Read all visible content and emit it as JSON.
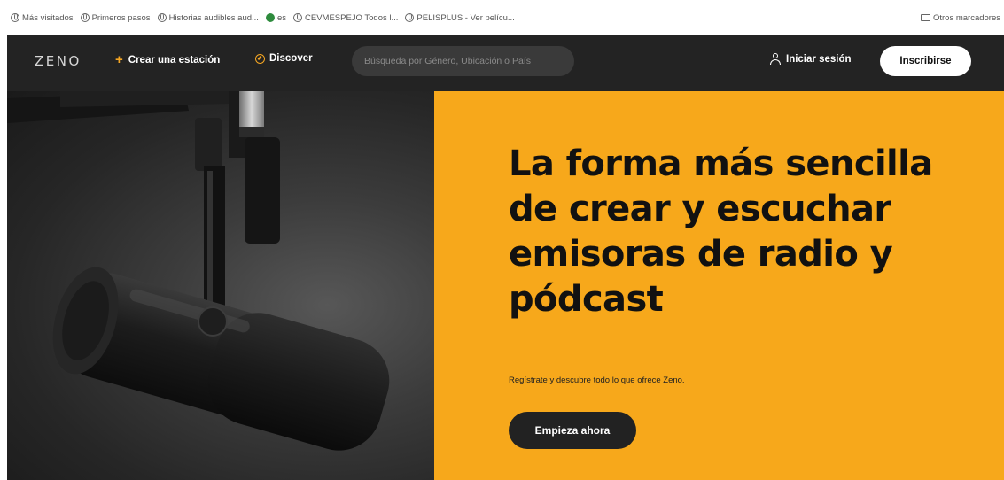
{
  "bookmarks": {
    "items": [
      {
        "label": "Más visitados",
        "icon": "globe-icon"
      },
      {
        "label": "Primeros pasos",
        "icon": "globe-icon"
      },
      {
        "label": "Historias audibles aud...",
        "icon": "globe-icon"
      },
      {
        "label": "es",
        "icon": "green-circle-icon"
      },
      {
        "label": "CEVMESPEJO Todos l...",
        "icon": "globe-icon"
      },
      {
        "label": "PELISPLUS - Ver pelícu...",
        "icon": "globe-icon"
      }
    ],
    "other": "Otros marcadores"
  },
  "nav": {
    "logo": "ZENO",
    "create_label": "Crear una estación",
    "discover_label": "Discover",
    "search_placeholder": "Búsqueda por Género, Ubicación o País",
    "login_label": "Iniciar sesión",
    "signup_label": "Inscribirse"
  },
  "hero": {
    "headline": "La forma más sencilla de crear y escuchar emisoras de radio y pódcast",
    "subtext": "Regístrate y descubre todo lo que ofrece Zeno.",
    "cta_label": "Empieza ahora"
  },
  "colors": {
    "accent": "#f7a81b",
    "nav_bg": "#232323",
    "cta_bg": "#222222"
  }
}
